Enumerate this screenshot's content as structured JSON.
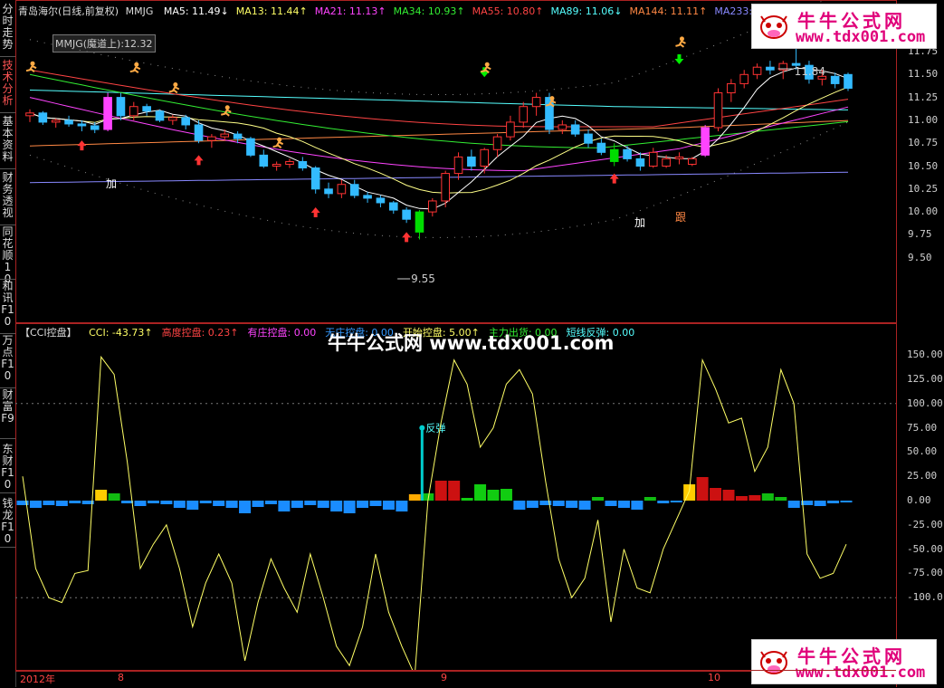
{
  "left_tabs": [
    {
      "label": "分时走势"
    },
    {
      "label": "技术分析",
      "active": true
    },
    {
      "label": "基本资料"
    },
    {
      "label": "财务透视"
    },
    {
      "label": "同花顺10"
    },
    {
      "label": "和讯F10"
    },
    {
      "label": "万点F10"
    },
    {
      "label": "财富F9"
    },
    {
      "label": "东财F10"
    },
    {
      "label": "钱龙F10"
    }
  ],
  "main_header": {
    "stock": "青岛海尔(日线,前复权)",
    "indicator": "MMJG",
    "ma": [
      {
        "text": "MA5: 11.49↓",
        "color": "#ffffff"
      },
      {
        "text": "MA13: 11.44↑",
        "color": "#ffff66"
      },
      {
        "text": "MA21: 11.13↑",
        "color": "#ff44ff"
      },
      {
        "text": "MA34: 10.93↑",
        "color": "#33ee33"
      },
      {
        "text": "MA55: 10.80↑",
        "color": "#ff4444"
      },
      {
        "text": "MA89: 11.06↓",
        "color": "#55ffff"
      },
      {
        "text": "MA144: 11.11↑",
        "color": "#ff8844"
      },
      {
        "text": "MA233: 10.44",
        "color": "#8888ff"
      }
    ]
  },
  "mmjg_box": "MMJG(魔道上):12.32",
  "price_labels": [
    "11.75",
    "11.50",
    "11.25",
    "11.00",
    "10.75",
    "10.50",
    "10.25",
    "10.00",
    "9.75",
    "9.50"
  ],
  "cci_labels": [
    "150.00",
    "125.00",
    "100.00",
    "75.00",
    "50.00",
    "25.00",
    "0.00",
    "-25.00",
    "-50.00",
    "-75.00",
    "-100.0"
  ],
  "annotations": {
    "low_price": "9.55",
    "high_price": "11.84",
    "add1": "加",
    "add2": "加",
    "follow": "跟",
    "rebound": "反弹"
  },
  "sub_header": {
    "title": "【CCI控盘】",
    "items": [
      {
        "text": "CCI: -43.73↑",
        "color": "#ffff66"
      },
      {
        "text": "高度控盘: 0.23↑",
        "color": "#ff4444"
      },
      {
        "text": "有庄控盘: 0.00",
        "color": "#ff44ff"
      },
      {
        "text": "无庄控盘: 0.00",
        "color": "#3399ff"
      },
      {
        "text": "开始控盘: 5.00↑",
        "color": "#ffff66"
      },
      {
        "text": "主力出货: 0.00",
        "color": "#33ee33"
      },
      {
        "text": "短线反弹: 0.00",
        "color": "#55ffff"
      }
    ]
  },
  "watermark": "牛牛公式网 www.tdx001.com",
  "logo": {
    "title": "牛牛公式网",
    "url": "www.tdx001.com"
  },
  "x_axis": [
    "2012年",
    "8",
    "9",
    "10"
  ],
  "chart_data": {
    "type": "candlestick",
    "ylim": [
      9.4,
      11.9
    ],
    "candles": [
      [
        11.05,
        11.12,
        10.98,
        11.08
      ],
      [
        11.08,
        11.1,
        10.95,
        10.98
      ],
      [
        10.98,
        11.02,
        10.92,
        11.0
      ],
      [
        11.0,
        11.05,
        10.93,
        10.96
      ],
      [
        10.96,
        11.0,
        10.88,
        10.94
      ],
      [
        10.94,
        10.98,
        10.86,
        10.9
      ],
      [
        10.9,
        11.3,
        10.88,
        11.25
      ],
      [
        11.25,
        11.3,
        11.0,
        11.05
      ],
      [
        11.05,
        11.2,
        11.0,
        11.15
      ],
      [
        11.15,
        11.18,
        11.05,
        11.1
      ],
      [
        11.1,
        11.12,
        10.98,
        11.0
      ],
      [
        11.0,
        11.06,
        10.95,
        11.03
      ],
      [
        11.03,
        11.06,
        10.9,
        10.95
      ],
      [
        10.95,
        11.0,
        10.75,
        10.78
      ],
      [
        10.78,
        10.85,
        10.7,
        10.82
      ],
      [
        10.82,
        10.9,
        10.78,
        10.85
      ],
      [
        10.85,
        10.88,
        10.75,
        10.8
      ],
      [
        10.8,
        10.82,
        10.6,
        10.62
      ],
      [
        10.62,
        10.68,
        10.48,
        10.5
      ],
      [
        10.5,
        10.55,
        10.45,
        10.52
      ],
      [
        10.52,
        10.58,
        10.48,
        10.55
      ],
      [
        10.55,
        10.6,
        10.45,
        10.48
      ],
      [
        10.48,
        10.5,
        10.2,
        10.25
      ],
      [
        10.25,
        10.32,
        10.15,
        10.2
      ],
      [
        10.2,
        10.35,
        10.15,
        10.3
      ],
      [
        10.3,
        10.35,
        10.15,
        10.18
      ],
      [
        10.18,
        10.22,
        10.1,
        10.15
      ],
      [
        10.15,
        10.18,
        10.05,
        10.1
      ],
      [
        10.1,
        10.12,
        9.98,
        10.02
      ],
      [
        10.02,
        10.05,
        9.88,
        9.92
      ],
      [
        9.78,
        10.02,
        9.7,
        10.0
      ],
      [
        10.0,
        10.15,
        9.95,
        10.12
      ],
      [
        10.12,
        10.45,
        10.05,
        10.42
      ],
      [
        10.42,
        10.65,
        10.35,
        10.6
      ],
      [
        10.6,
        10.68,
        10.45,
        10.5
      ],
      [
        10.5,
        10.7,
        10.42,
        10.68
      ],
      [
        10.68,
        10.85,
        10.6,
        10.82
      ],
      [
        10.82,
        11.05,
        10.78,
        10.98
      ],
      [
        10.98,
        11.2,
        10.92,
        11.15
      ],
      [
        11.15,
        11.3,
        11.05,
        11.25
      ],
      [
        11.25,
        11.3,
        10.85,
        10.9
      ],
      [
        10.9,
        11.0,
        10.85,
        10.95
      ],
      [
        10.95,
        11.0,
        10.82,
        10.85
      ],
      [
        10.85,
        10.9,
        10.7,
        10.75
      ],
      [
        10.75,
        10.8,
        10.62,
        10.65
      ],
      [
        10.55,
        10.75,
        10.5,
        10.68
      ],
      [
        10.68,
        10.72,
        10.55,
        10.58
      ],
      [
        10.58,
        10.65,
        10.45,
        10.5
      ],
      [
        10.5,
        10.7,
        10.48,
        10.65
      ],
      [
        10.5,
        10.62,
        10.48,
        10.58
      ],
      [
        10.58,
        10.65,
        10.52,
        10.6
      ],
      [
        10.52,
        10.6,
        10.5,
        10.58
      ],
      [
        10.62,
        10.95,
        10.6,
        10.92
      ],
      [
        10.92,
        11.35,
        10.88,
        11.3
      ],
      [
        11.3,
        11.45,
        11.2,
        11.4
      ],
      [
        11.4,
        11.55,
        11.35,
        11.5
      ],
      [
        11.5,
        11.62,
        11.45,
        11.58
      ],
      [
        11.58,
        11.65,
        11.5,
        11.55
      ],
      [
        11.55,
        11.65,
        11.45,
        11.62
      ],
      [
        11.62,
        11.84,
        11.55,
        11.6
      ],
      [
        11.6,
        11.65,
        11.4,
        11.45
      ],
      [
        11.45,
        11.55,
        11.38,
        11.48
      ],
      [
        11.48,
        11.52,
        11.35,
        11.4
      ],
      [
        11.5,
        11.52,
        11.32,
        11.35
      ]
    ],
    "cci": [
      25,
      -70,
      -100,
      -105,
      -75,
      -72,
      148,
      130,
      40,
      -70,
      -45,
      -25,
      -70,
      -130,
      -85,
      -55,
      -85,
      -165,
      -105,
      -60,
      -90,
      -115,
      -55,
      -100,
      -150,
      -170,
      -130,
      -55,
      -115,
      -150,
      -180,
      0,
      80,
      145,
      120,
      55,
      75,
      120,
      135,
      110,
      20,
      -60,
      -100,
      -80,
      -20,
      -125,
      -50,
      -90,
      -95,
      -50,
      -20,
      10,
      145,
      115,
      80,
      85,
      30,
      55,
      135,
      100,
      -55,
      -80,
      -75,
      -45
    ],
    "cci_bars": [
      -5,
      -8,
      -5,
      -6,
      -3,
      -4,
      12,
      8,
      -3,
      -6,
      -3,
      -4,
      -8,
      -10,
      -3,
      -6,
      -8,
      -14,
      -7,
      -4,
      -12,
      -8,
      -5,
      -8,
      -12,
      -14,
      -8,
      -6,
      -10,
      -12,
      7,
      8,
      22,
      22,
      3,
      18,
      12,
      13,
      -10,
      -8,
      -5,
      -6,
      -8,
      -10,
      4,
      -6,
      -8,
      -10,
      4,
      -3,
      -2,
      18,
      26,
      14,
      12,
      5,
      6,
      8,
      4,
      -8,
      -5,
      -6,
      -3,
      -2
    ]
  }
}
